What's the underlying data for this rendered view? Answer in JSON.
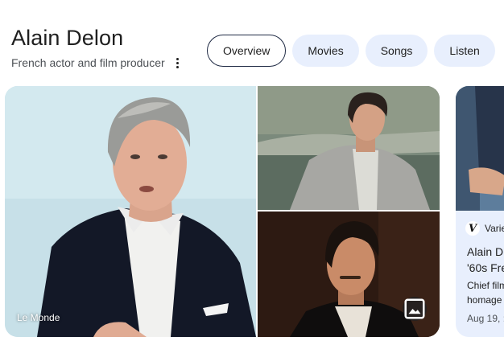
{
  "entity": {
    "title": "Alain Delon",
    "subtitle": "French actor and film producer",
    "more_icon": "more-vert-icon"
  },
  "tabs": [
    {
      "label": "Overview",
      "active": true
    },
    {
      "label": "Movies",
      "active": false
    },
    {
      "label": "Songs",
      "active": false
    },
    {
      "label": "Listen",
      "active": false
    }
  ],
  "gallery": {
    "main_source": "Le Monde",
    "view_images_icon": "image-icon"
  },
  "news_card": {
    "source_logo": "V",
    "source_name": "Varie",
    "title": "Alain D '60s Fre",
    "title_lines": [
      "Alain D",
      "'60s Fre"
    ],
    "snippet_lines": [
      "Chief film",
      "homage"
    ],
    "date": "Aug 19, :"
  },
  "colors": {
    "chip_bg": "#e8effd",
    "active_border": "#1f2a44",
    "text": "#1f1f1f",
    "muted": "#4d5156"
  }
}
